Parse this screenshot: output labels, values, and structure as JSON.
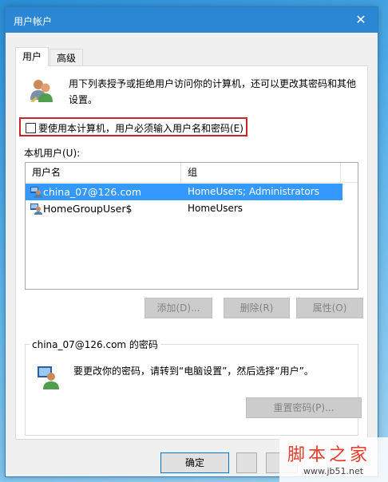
{
  "window": {
    "title": "用户帐户",
    "close_glyph": "✕"
  },
  "tabs": [
    {
      "label": "用户",
      "active": true
    },
    {
      "label": "高级",
      "active": false
    }
  ],
  "intro_text": "用下列表授予或拒绝用户访问你的计算机，还可以更改其密码和其他设置。",
  "require_login": {
    "label": "要使用本计算机，用户必须输入用户名和密码(E)",
    "checked": false
  },
  "users_label": "本机用户(U):",
  "users_table": {
    "columns": [
      "用户名",
      "组"
    ],
    "rows": [
      {
        "name": "china_07@126.com",
        "group": "HomeUsers; Administrators",
        "selected": true
      },
      {
        "name": "HomeGroupUser$",
        "group": "HomeUsers",
        "selected": false
      }
    ]
  },
  "buttons": {
    "add": "添加(D)...",
    "remove": "删除(R)",
    "properties": "属性(O)"
  },
  "password_group": {
    "legend": "china_07@126.com 的密码",
    "text": "要更改你的密码，请转到“电脑设置”，然后选择“用户”。",
    "reset_button": "重置密码(P)..."
  },
  "footer": {
    "ok": "确定"
  },
  "watermark": {
    "brand": "脚本之家",
    "url": "www.jb51.net"
  },
  "colors": {
    "titlebar": "#2b87d3",
    "selection": "#3399ff",
    "highlight_border": "#c62828"
  }
}
